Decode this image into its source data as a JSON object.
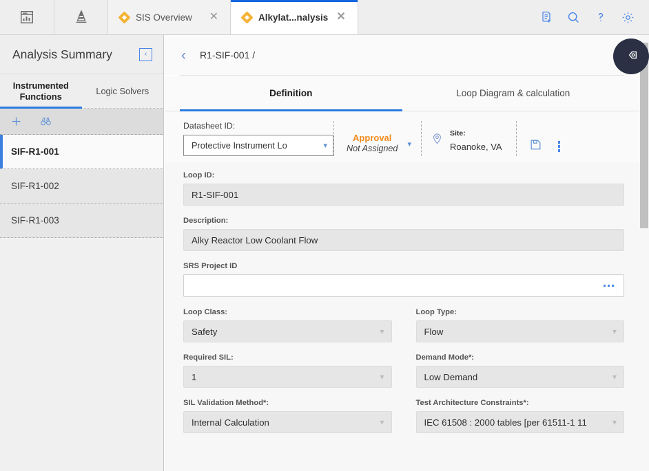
{
  "topbar": {
    "app_icon": "dashboard-icon",
    "hierarchy_icon": "pyramid-icon",
    "tabs": [
      {
        "label": "SIS Overview",
        "icon": "diamond-icon",
        "active": false,
        "close": "✕"
      },
      {
        "label": "Alkylat...nalysis",
        "icon": "diamond-icon",
        "active": true,
        "close": "✕"
      }
    ],
    "actions": [
      {
        "name": "new-document-icon"
      },
      {
        "name": "search-icon"
      },
      {
        "name": "help-icon"
      },
      {
        "name": "settings-icon"
      }
    ]
  },
  "sidebar": {
    "title": "Analysis Summary",
    "collapse_glyph": "‹",
    "tabs": [
      {
        "label": "Instrumented Functions",
        "active": true
      },
      {
        "label": "Logic Solvers",
        "active": false
      }
    ],
    "toolbar": [
      {
        "name": "add-icon",
        "glyph": "+"
      },
      {
        "name": "find-icon",
        "glyph": "binoculars"
      }
    ],
    "items": [
      {
        "label": "SIF-R1-001",
        "selected": true
      },
      {
        "label": "SIF-R1-002",
        "selected": false
      },
      {
        "label": "SIF-R1-003",
        "selected": false
      }
    ]
  },
  "main": {
    "breadcrumb": "R1-SIF-001 /",
    "back_glyph": "‹",
    "tabs": [
      {
        "label": "Definition",
        "active": true
      },
      {
        "label": "Loop Diagram & calculation",
        "active": false
      }
    ],
    "datasheet": {
      "label": "Datasheet ID:",
      "value": "Protective Instrument Lo",
      "approval_title": "Approval",
      "approval_status": "Not Assigned",
      "site_label": "Site:",
      "site_value": "Roanoke, VA",
      "save_icon": "save-icon",
      "more_icon": "more-vertical-icon"
    },
    "form": {
      "loop_id": {
        "label": "Loop ID:",
        "value": "R1-SIF-001"
      },
      "description": {
        "label": "Description:",
        "value": "Alky Reactor Low Coolant Flow"
      },
      "srs_project_id": {
        "label": "SRS Project ID",
        "value": ""
      },
      "loop_class": {
        "label": "Loop Class:",
        "value": "Safety"
      },
      "loop_type": {
        "label": "Loop Type:",
        "value": "Flow"
      },
      "required_sil": {
        "label": "Required SIL:",
        "value": "1"
      },
      "demand_mode": {
        "label": "Demand Mode*:",
        "value": "Low Demand"
      },
      "sil_validation_method": {
        "label": "SIL Validation Method*:",
        "value": "Internal Calculation"
      },
      "test_architecture_constraints": {
        "label": "Test Architecture Constraints*:",
        "value": "IEC 61508 : 2000 tables [per 61511-1 11"
      }
    }
  },
  "fab": {
    "name": "help-pointer-icon"
  },
  "colors": {
    "accent_blue": "#2a7ade",
    "link_blue": "#4a86e8",
    "approval_orange": "#f08c1e",
    "tab_diamond": "#f5b335",
    "fab_dark": "#2b3044"
  }
}
